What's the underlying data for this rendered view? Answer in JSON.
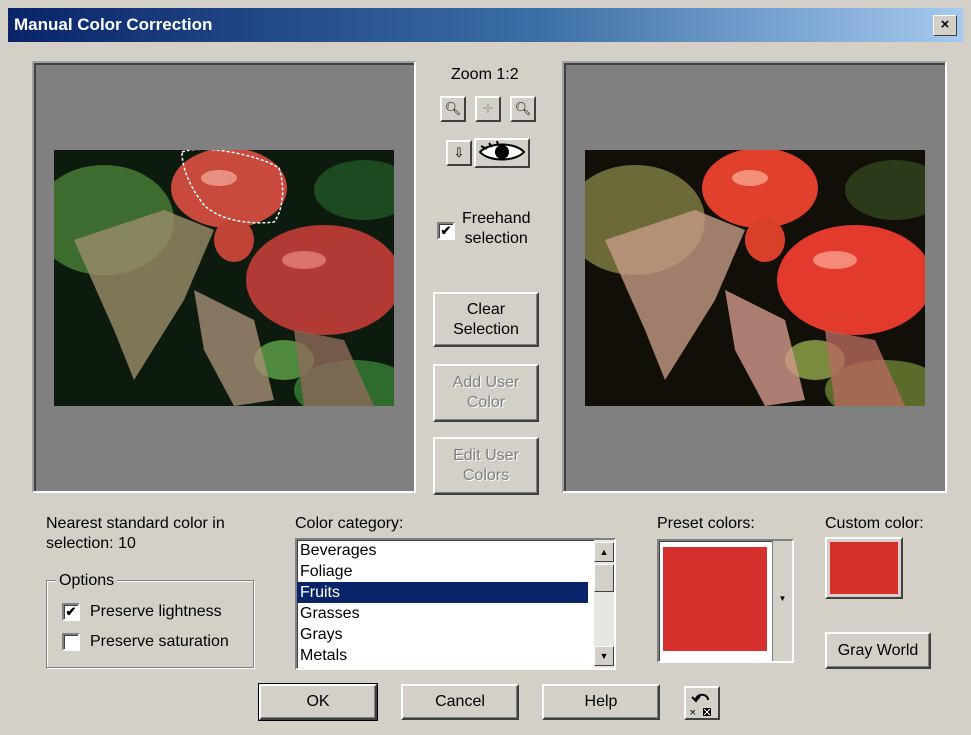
{
  "window": {
    "title": "Manual Color Correction",
    "close": "×"
  },
  "zoom": {
    "label": "Zoom 1:2"
  },
  "freehand": {
    "label": "Freehand\nselection",
    "checked": true
  },
  "buttons": {
    "clear": "Clear\nSelection",
    "add_user_color": "Add User\nColor",
    "edit_user_colors": "Edit User\nColors",
    "gray_world": "Gray World",
    "ok": "OK",
    "cancel": "Cancel",
    "help": "Help"
  },
  "nearest": {
    "text": "Nearest standard color in\nselection: 10"
  },
  "options": {
    "legend": "Options",
    "preserve_lightness": {
      "label": "Preserve lightness",
      "checked": true
    },
    "preserve_saturation": {
      "label": "Preserve saturation",
      "checked": false
    }
  },
  "category": {
    "label": "Color category:",
    "items": [
      "Beverages",
      "Foliage",
      "Fruits",
      "Grasses",
      "Grays",
      "Metals"
    ],
    "selected": "Fruits"
  },
  "preset": {
    "label": "Preset colors:",
    "color": "#d5302b"
  },
  "custom": {
    "label": "Custom color:",
    "color": "#d5302b"
  },
  "check_mark": "✔",
  "icons": {
    "zoom_out": "zoom-out-icon",
    "pan": "pan-icon",
    "zoom_in": "zoom-in-icon",
    "dropper": "dropper-icon",
    "eye": "eye-icon",
    "undo": "undo-icon"
  }
}
